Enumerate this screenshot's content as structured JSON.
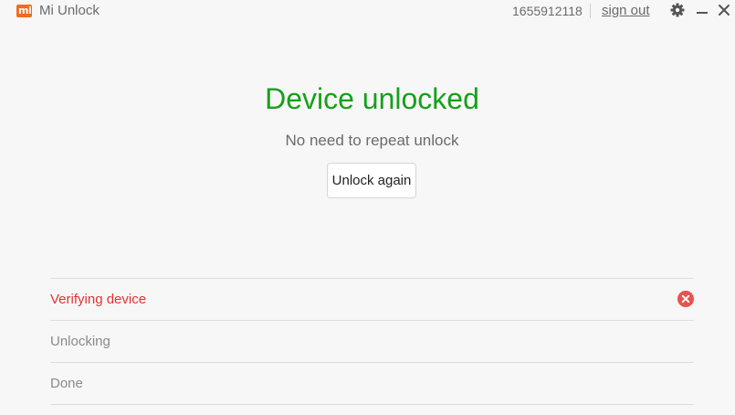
{
  "titlebar": {
    "logo_text": "mi",
    "app_title": "Mi Unlock",
    "account_id": "1655912118",
    "sign_out_label": "sign out",
    "icons": {
      "settings": "gear-icon",
      "minimize": "minimize-icon",
      "close": "close-icon"
    }
  },
  "main": {
    "status_title": "Device unlocked",
    "status_subtitle": "No need to repeat unlock",
    "unlock_again_label": "Unlock again"
  },
  "steps": [
    {
      "label": "Verifying device",
      "state": "error",
      "icon": "error-icon"
    },
    {
      "label": "Unlocking",
      "state": "pending"
    },
    {
      "label": "Done",
      "state": "pending"
    }
  ],
  "colors": {
    "brand": "#f26b1d",
    "success": "#17a01a",
    "error": "#e03434",
    "error_icon": "#e9534d",
    "background": "#f7f7f7"
  }
}
